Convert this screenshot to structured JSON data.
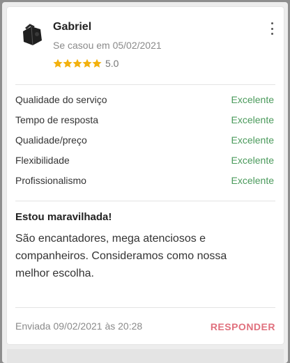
{
  "review": {
    "reviewer_name": "Gabriel",
    "married_text": "Se casou em 05/02/2021",
    "rating": 5,
    "rating_text": "5.0",
    "star_color": "#f3b10d",
    "avatar_icon": "avatar-photo-icon",
    "more_icon": "vertical-dots-icon",
    "criteria": [
      {
        "label": "Qualidade do serviço",
        "value": "Excelente"
      },
      {
        "label": "Tempo de resposta",
        "value": "Excelente"
      },
      {
        "label": "Qualidade/preço",
        "value": "Excelente"
      },
      {
        "label": "Flexibilidade",
        "value": "Excelente"
      },
      {
        "label": "Profissionalismo",
        "value": "Excelente"
      }
    ],
    "criteria_value_color": "#4a9a5b",
    "title": "Estou maravilhada!",
    "body": "São encantadores, mega atenciosos e companheiros. Consideramos como nossa melhor escolha.",
    "sent_text": "Enviada 09/02/2021 às 20:28",
    "reply_label": "RESPONDER",
    "reply_color": "#e0707d"
  }
}
